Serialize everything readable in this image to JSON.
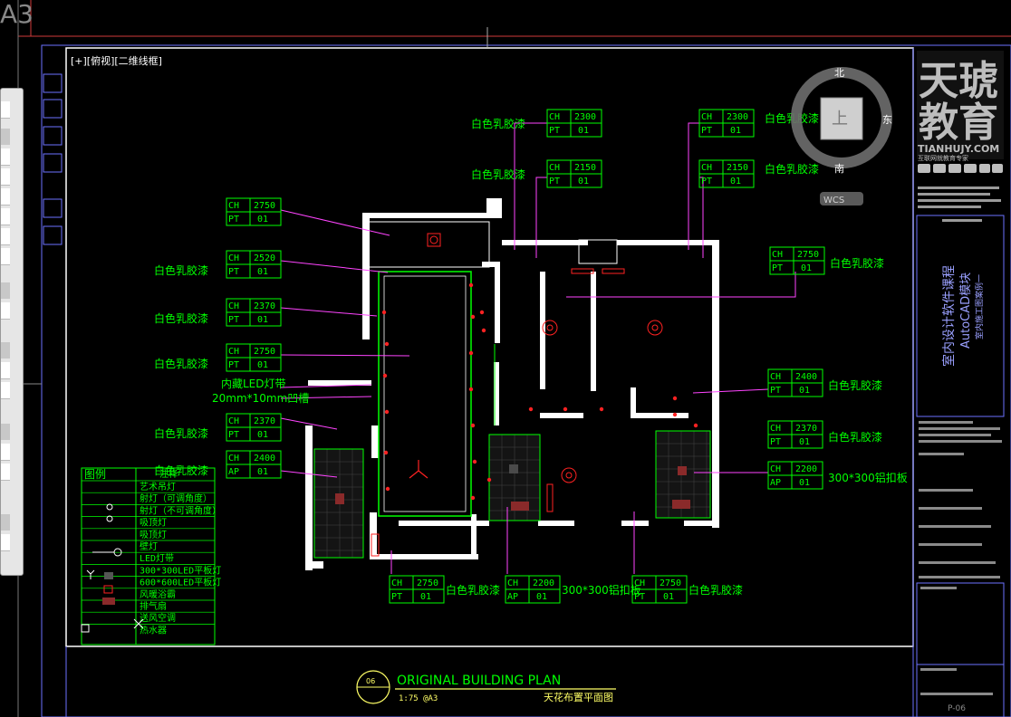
{
  "viewport_label": "[+][俯视][二维线框]",
  "sheet_corner_label": "A3",
  "compass": {
    "north": "北",
    "east": "东",
    "south": "南",
    "center": "上",
    "wcs": "WCS"
  },
  "brand": {
    "logo_line1": "天琥",
    "logo_line2": "教育",
    "site": "TIANHUJY.COM",
    "tagline": "互联网就教育专家",
    "course_title": "室内设计软件课程",
    "module": "AutoCAD模块",
    "case": "室内施工图案例一"
  },
  "title_block": {
    "number": "06",
    "title": "ORIGINAL BUILDING PLAN",
    "scale": "1:75 @A3",
    "subtitle": "天花布置平面图",
    "sheet_no": "P-06"
  },
  "tags": {
    "t1": {
      "ch": "2300",
      "code": "PT",
      "v": "01",
      "note": "白色乳胶漆"
    },
    "t2": {
      "ch": "2150",
      "code": "PT",
      "v": "01",
      "note": "白色乳胶漆"
    },
    "t3": {
      "ch": "2300",
      "code": "PT",
      "v": "01",
      "note": "白色乳胶漆"
    },
    "t4": {
      "ch": "2150",
      "code": "PT",
      "v": "01",
      "note": "白色乳胶漆"
    },
    "t5": {
      "ch": "2750",
      "code": "PT",
      "v": "01",
      "note": "白色乳胶漆"
    },
    "t6": {
      "ch": "2520",
      "code": "PT",
      "v": "01",
      "note": "白色乳胶漆"
    },
    "t7": {
      "ch": "2370",
      "code": "PT",
      "v": "01",
      "note": "白色乳胶漆"
    },
    "t8": {
      "ch": "2750",
      "code": "PT",
      "v": "01",
      "note": "白色乳胶漆"
    },
    "t9": {
      "ch": "2370",
      "code": "PT",
      "v": "01",
      "note": "白色乳胶漆"
    },
    "t10": {
      "ch": "2400",
      "code": "AP",
      "v": "01",
      "note": "白色乳胶漆"
    },
    "t11": {
      "ch": "2750",
      "code": "PT",
      "v": "01"
    },
    "t12": {
      "ch": "2400",
      "code": "PT",
      "v": "01",
      "note": "白色乳胶漆"
    },
    "t13": {
      "ch": "2370",
      "code": "PT",
      "v": "01",
      "note": "白色乳胶漆"
    },
    "t14": {
      "ch": "2200",
      "code": "AP",
      "v": "01",
      "note": "300*300铝扣板"
    },
    "t15": {
      "ch": "2750",
      "code": "PT",
      "v": "01",
      "note": "白色乳胶漆"
    },
    "t16": {
      "ch": "2200",
      "code": "AP",
      "v": "01",
      "note": "300*300铝扣板"
    },
    "t17": {
      "ch": "2750",
      "code": "PT",
      "v": "01",
      "note": "白色乳胶漆"
    }
  },
  "notes": {
    "led": "内藏LED灯带",
    "groove": "20mm*10mm凹槽"
  },
  "legend": {
    "header_a": "图例",
    "header_b": "注释",
    "rows": [
      "艺术吊灯",
      "射灯（可调角度）",
      "射灯（不可调角度）",
      "吸顶灯",
      "吸顶灯",
      "壁灯",
      "LED灯带",
      "300*300LED平板灯",
      "600*600LED平板灯",
      "风暖浴霸",
      "排气扇",
      "送风空调",
      "热水器"
    ]
  }
}
